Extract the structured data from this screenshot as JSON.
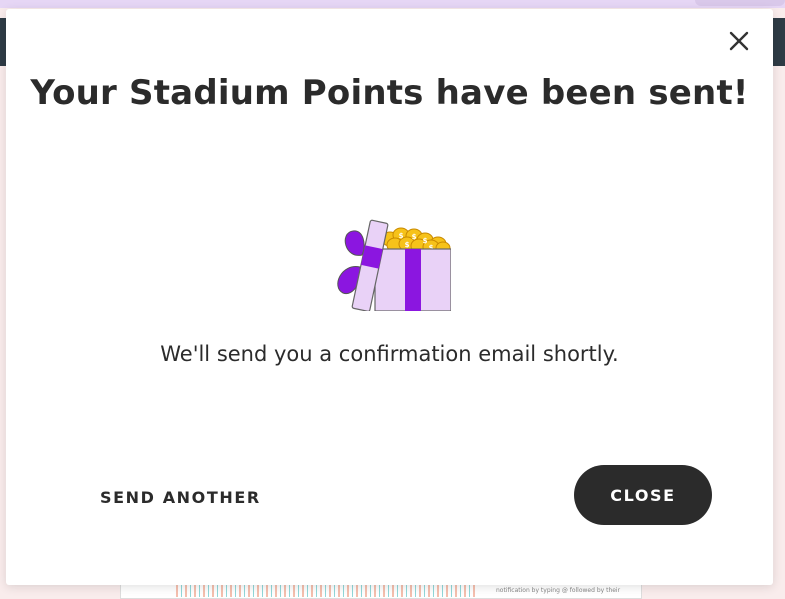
{
  "modal": {
    "title": "Your Stadium Points have been sent!",
    "message": "We'll send you a confirmation email shortly.",
    "send_another_label": "SEND ANOTHER",
    "close_label": "CLOSE"
  },
  "background": {
    "snippet_text": "notification by typing @ followed by their"
  },
  "colors": {
    "primary_dark": "#2b2b2b",
    "accent_purple": "#8b16e0",
    "box_lilac": "#e9d2f7",
    "coin_gold": "#f6c21a"
  },
  "icons": {
    "close": "close-icon",
    "gift": "gift-box-coins-icon"
  }
}
